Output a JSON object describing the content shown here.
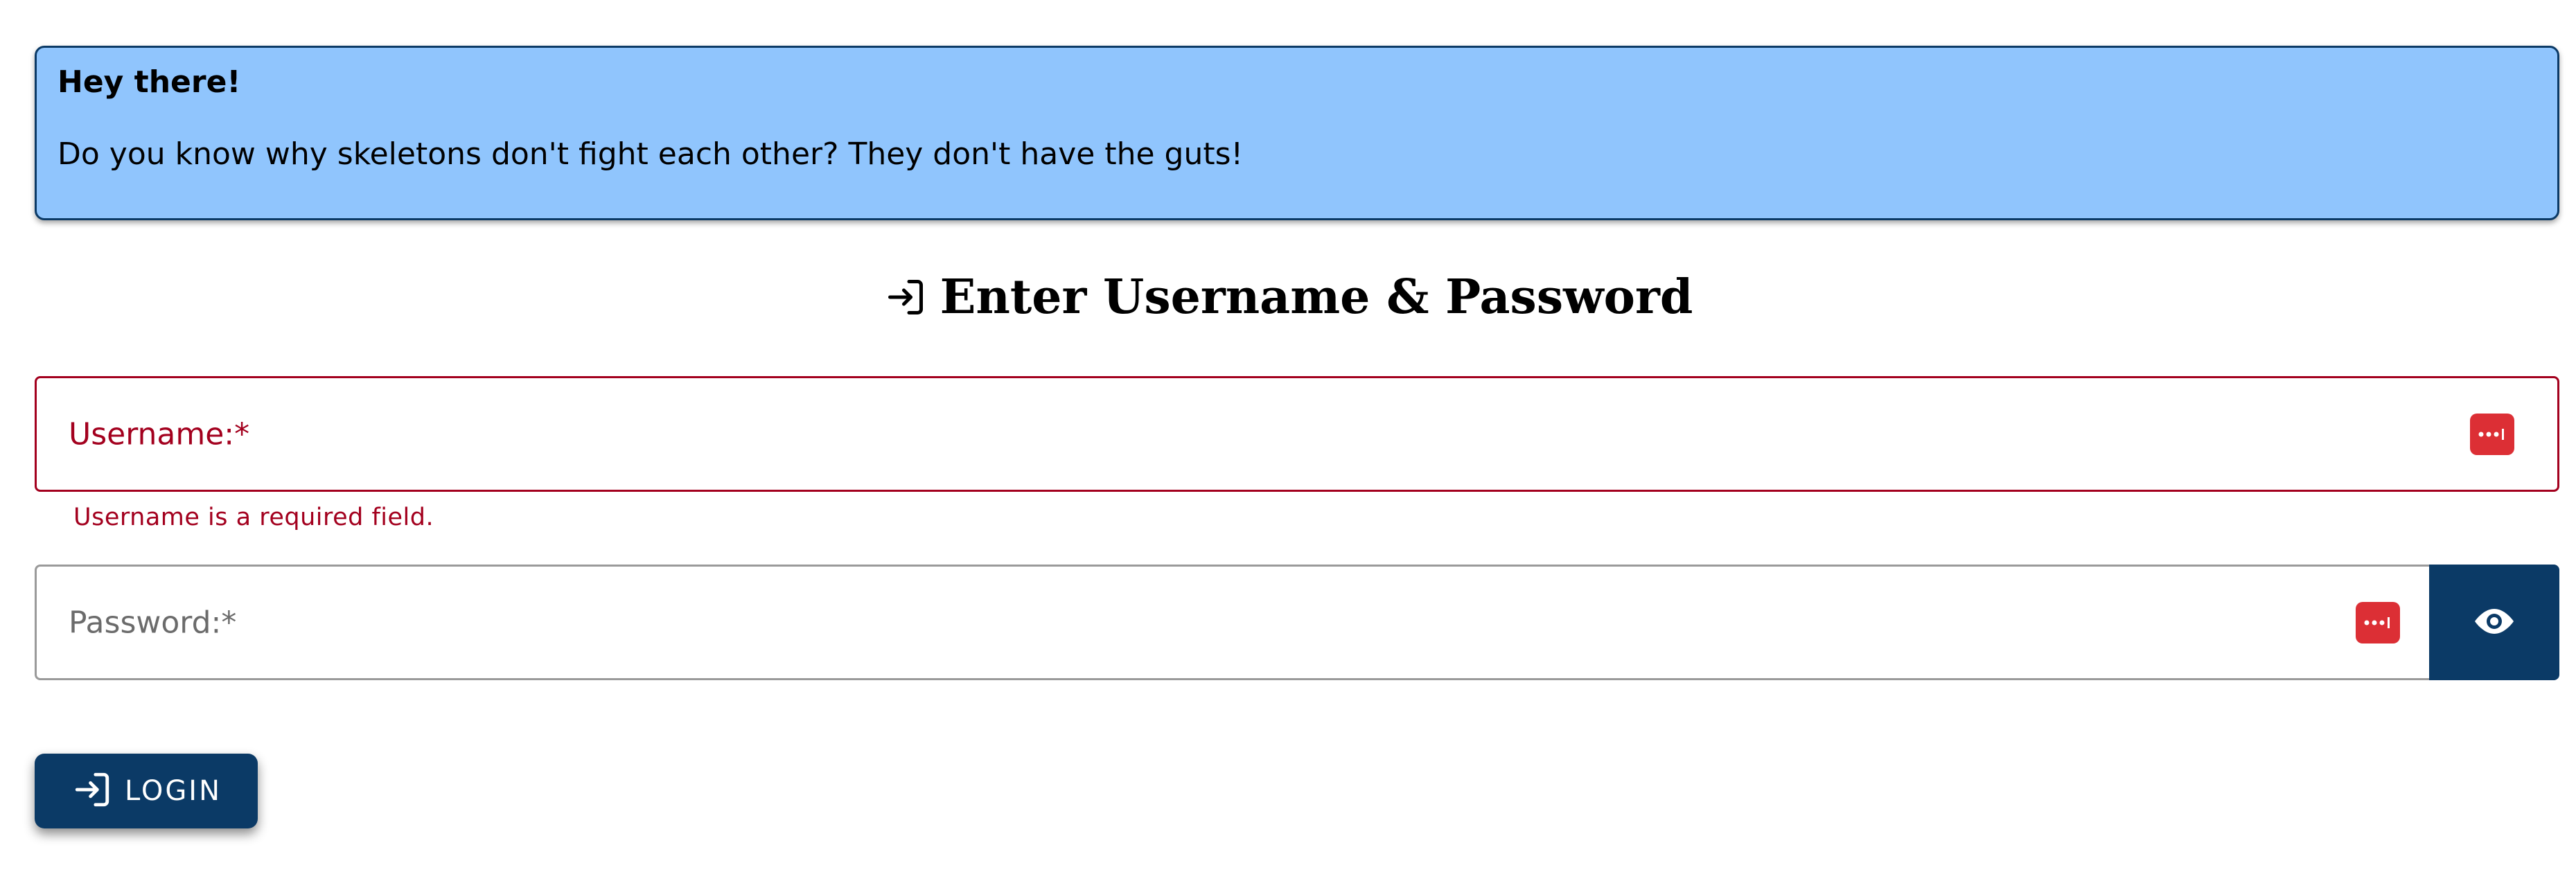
{
  "alert": {
    "title": "Hey there!",
    "message": "Do you know why skeletons don't fight each other? They don't have the guts!"
  },
  "heading": {
    "icon": "login-icon",
    "text": "Enter Username & Password"
  },
  "username": {
    "label": "Username:*",
    "error": "Username is a required field.",
    "icon": "password-manager-icon"
  },
  "password": {
    "label": "Password:*",
    "icon": "password-manager-icon",
    "toggle_icon": "eye-icon"
  },
  "login_button": {
    "label": "LOGIN",
    "icon": "login-icon"
  },
  "colors": {
    "alert_background": "#90c5fd",
    "primary": "#0b3a66",
    "error": "#a3001e",
    "password_manager": "#dc2f35"
  }
}
